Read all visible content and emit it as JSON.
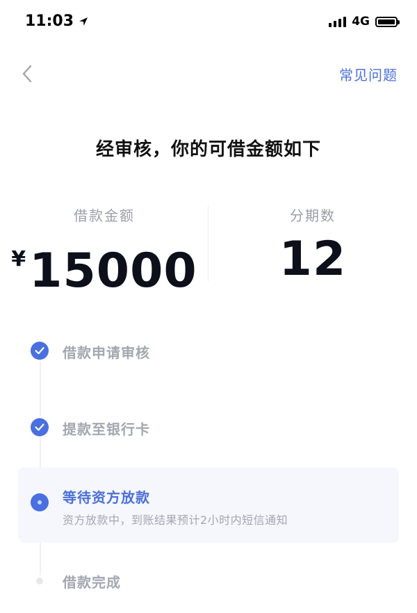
{
  "status_bar": {
    "time": "11:03",
    "network": "4G",
    "icons": [
      "location-arrow-icon",
      "signal-icon",
      "battery-icon"
    ]
  },
  "nav": {
    "back_icon": "chevron-left-icon",
    "faq_label": "常见问题"
  },
  "title": "经审核，你的可借金额如下",
  "summary": {
    "amount_label": "借款金额",
    "currency": "¥",
    "amount_value": "15000",
    "term_label": "分期数",
    "term_value": "12"
  },
  "steps": [
    {
      "label": "借款申请审核",
      "status": "done",
      "icon": "check-circle-icon"
    },
    {
      "label": "提款至银行卡",
      "status": "done",
      "icon": "check-circle-icon"
    },
    {
      "label": "等待资方放款",
      "status": "active",
      "description": "资方放款中，到账结果预计2小时内短信通知",
      "icon": "active-dot-icon"
    },
    {
      "label": "借款完成",
      "status": "pending",
      "icon": "pending-dot-icon"
    }
  ],
  "colors": {
    "accent": "#4a6fd8",
    "muted_text": "#a3a7b0",
    "active_card_bg": "#f5f7fd"
  }
}
